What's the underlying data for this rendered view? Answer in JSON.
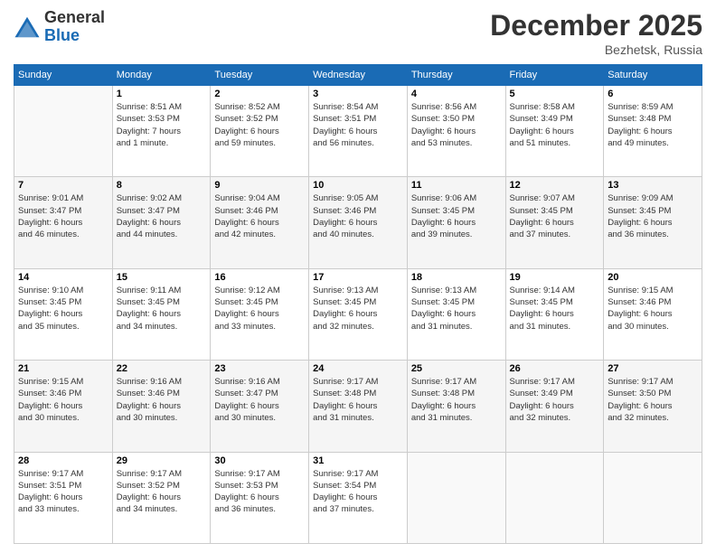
{
  "header": {
    "logo_general": "General",
    "logo_blue": "Blue",
    "month_title": "December 2025",
    "location": "Bezhetsk, Russia"
  },
  "weekdays": [
    "Sunday",
    "Monday",
    "Tuesday",
    "Wednesday",
    "Thursday",
    "Friday",
    "Saturday"
  ],
  "weeks": [
    [
      {
        "day": "",
        "info": ""
      },
      {
        "day": "1",
        "info": "Sunrise: 8:51 AM\nSunset: 3:53 PM\nDaylight: 7 hours\nand 1 minute."
      },
      {
        "day": "2",
        "info": "Sunrise: 8:52 AM\nSunset: 3:52 PM\nDaylight: 6 hours\nand 59 minutes."
      },
      {
        "day": "3",
        "info": "Sunrise: 8:54 AM\nSunset: 3:51 PM\nDaylight: 6 hours\nand 56 minutes."
      },
      {
        "day": "4",
        "info": "Sunrise: 8:56 AM\nSunset: 3:50 PM\nDaylight: 6 hours\nand 53 minutes."
      },
      {
        "day": "5",
        "info": "Sunrise: 8:58 AM\nSunset: 3:49 PM\nDaylight: 6 hours\nand 51 minutes."
      },
      {
        "day": "6",
        "info": "Sunrise: 8:59 AM\nSunset: 3:48 PM\nDaylight: 6 hours\nand 49 minutes."
      }
    ],
    [
      {
        "day": "7",
        "info": "Sunrise: 9:01 AM\nSunset: 3:47 PM\nDaylight: 6 hours\nand 46 minutes."
      },
      {
        "day": "8",
        "info": "Sunrise: 9:02 AM\nSunset: 3:47 PM\nDaylight: 6 hours\nand 44 minutes."
      },
      {
        "day": "9",
        "info": "Sunrise: 9:04 AM\nSunset: 3:46 PM\nDaylight: 6 hours\nand 42 minutes."
      },
      {
        "day": "10",
        "info": "Sunrise: 9:05 AM\nSunset: 3:46 PM\nDaylight: 6 hours\nand 40 minutes."
      },
      {
        "day": "11",
        "info": "Sunrise: 9:06 AM\nSunset: 3:45 PM\nDaylight: 6 hours\nand 39 minutes."
      },
      {
        "day": "12",
        "info": "Sunrise: 9:07 AM\nSunset: 3:45 PM\nDaylight: 6 hours\nand 37 minutes."
      },
      {
        "day": "13",
        "info": "Sunrise: 9:09 AM\nSunset: 3:45 PM\nDaylight: 6 hours\nand 36 minutes."
      }
    ],
    [
      {
        "day": "14",
        "info": "Sunrise: 9:10 AM\nSunset: 3:45 PM\nDaylight: 6 hours\nand 35 minutes."
      },
      {
        "day": "15",
        "info": "Sunrise: 9:11 AM\nSunset: 3:45 PM\nDaylight: 6 hours\nand 34 minutes."
      },
      {
        "day": "16",
        "info": "Sunrise: 9:12 AM\nSunset: 3:45 PM\nDaylight: 6 hours\nand 33 minutes."
      },
      {
        "day": "17",
        "info": "Sunrise: 9:13 AM\nSunset: 3:45 PM\nDaylight: 6 hours\nand 32 minutes."
      },
      {
        "day": "18",
        "info": "Sunrise: 9:13 AM\nSunset: 3:45 PM\nDaylight: 6 hours\nand 31 minutes."
      },
      {
        "day": "19",
        "info": "Sunrise: 9:14 AM\nSunset: 3:45 PM\nDaylight: 6 hours\nand 31 minutes."
      },
      {
        "day": "20",
        "info": "Sunrise: 9:15 AM\nSunset: 3:46 PM\nDaylight: 6 hours\nand 30 minutes."
      }
    ],
    [
      {
        "day": "21",
        "info": "Sunrise: 9:15 AM\nSunset: 3:46 PM\nDaylight: 6 hours\nand 30 minutes."
      },
      {
        "day": "22",
        "info": "Sunrise: 9:16 AM\nSunset: 3:46 PM\nDaylight: 6 hours\nand 30 minutes."
      },
      {
        "day": "23",
        "info": "Sunrise: 9:16 AM\nSunset: 3:47 PM\nDaylight: 6 hours\nand 30 minutes."
      },
      {
        "day": "24",
        "info": "Sunrise: 9:17 AM\nSunset: 3:48 PM\nDaylight: 6 hours\nand 31 minutes."
      },
      {
        "day": "25",
        "info": "Sunrise: 9:17 AM\nSunset: 3:48 PM\nDaylight: 6 hours\nand 31 minutes."
      },
      {
        "day": "26",
        "info": "Sunrise: 9:17 AM\nSunset: 3:49 PM\nDaylight: 6 hours\nand 32 minutes."
      },
      {
        "day": "27",
        "info": "Sunrise: 9:17 AM\nSunset: 3:50 PM\nDaylight: 6 hours\nand 32 minutes."
      }
    ],
    [
      {
        "day": "28",
        "info": "Sunrise: 9:17 AM\nSunset: 3:51 PM\nDaylight: 6 hours\nand 33 minutes."
      },
      {
        "day": "29",
        "info": "Sunrise: 9:17 AM\nSunset: 3:52 PM\nDaylight: 6 hours\nand 34 minutes."
      },
      {
        "day": "30",
        "info": "Sunrise: 9:17 AM\nSunset: 3:53 PM\nDaylight: 6 hours\nand 36 minutes."
      },
      {
        "day": "31",
        "info": "Sunrise: 9:17 AM\nSunset: 3:54 PM\nDaylight: 6 hours\nand 37 minutes."
      },
      {
        "day": "",
        "info": ""
      },
      {
        "day": "",
        "info": ""
      },
      {
        "day": "",
        "info": ""
      }
    ]
  ]
}
